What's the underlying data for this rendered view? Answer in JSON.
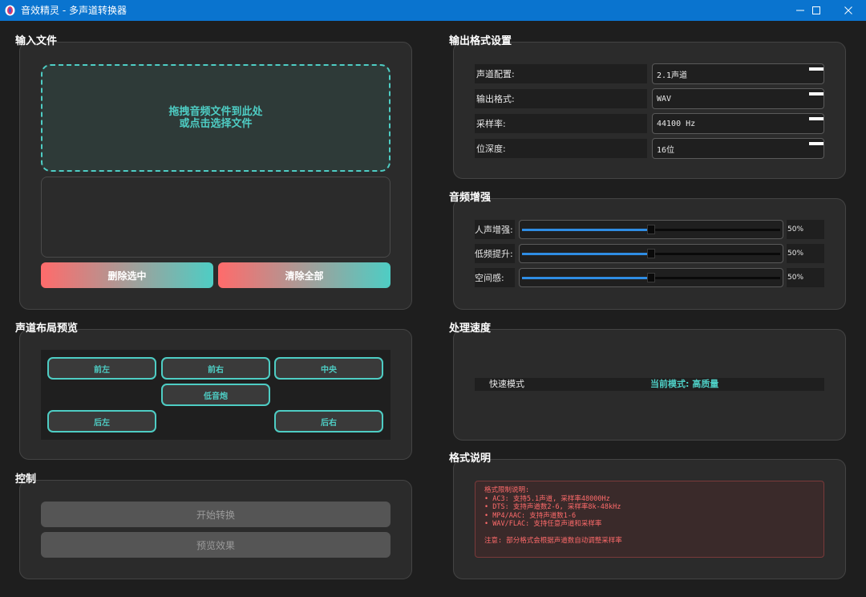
{
  "window": {
    "title": "音效精灵 - 多声道转换器",
    "controls": {
      "minimize": "minimize-icon",
      "maximize": "maximize-icon",
      "close": "close-icon"
    }
  },
  "input_files": {
    "group_title": "输入文件",
    "dropzone_line1": "拖拽音频文件到此处",
    "dropzone_line2": "或点击选择文件",
    "delete_selected_label": "删除选中",
    "clear_all_label": "清除全部"
  },
  "channel_layout": {
    "group_title": "声道布局预览",
    "channels": {
      "front_left": "前左",
      "front_right": "前右",
      "center": "中央",
      "subwoofer": "低音炮",
      "rear_left": "后左",
      "rear_right": "后右"
    }
  },
  "controls": {
    "group_title": "控制",
    "start_label": "开始转换",
    "preview_label": "预览效果"
  },
  "output_format": {
    "group_title": "输出格式设置",
    "rows": [
      {
        "label": "声道配置:",
        "value": "2.1声道"
      },
      {
        "label": "输出格式:",
        "value": "WAV"
      },
      {
        "label": "采样率:",
        "value": "44100 Hz"
      },
      {
        "label": "位深度:",
        "value": "16位"
      }
    ]
  },
  "enhancement": {
    "group_title": "音频增强",
    "sliders": [
      {
        "label": "人声增强:",
        "value": 50,
        "display": "50%"
      },
      {
        "label": "低频提升:",
        "value": 50,
        "display": "50%"
      },
      {
        "label": "空间感:",
        "value": 50,
        "display": "50%"
      }
    ]
  },
  "speed": {
    "group_title": "处理速度",
    "fast_mode_label": "快速模式",
    "fast_mode_checked": false,
    "current_mode": "当前模式: 高质量"
  },
  "format_info": {
    "group_title": "格式说明",
    "lines": [
      "格式限制说明:",
      "• AC3: 支持5.1声道, 采样率48000Hz",
      "• DTS: 支持声道数2-6, 采样率8k-48kHz",
      "• MP4/AAC: 支持声道数1-6",
      "• WAV/FLAC: 支持任意声道和采样率",
      "",
      "注意: 部分格式会根据声道数自动调整采样率"
    ]
  },
  "colors": {
    "accent": "#4ecdc4",
    "warm": "#ff6b6b",
    "titlebar": "#0a74cf",
    "slider_fill": "#2f8de4"
  }
}
